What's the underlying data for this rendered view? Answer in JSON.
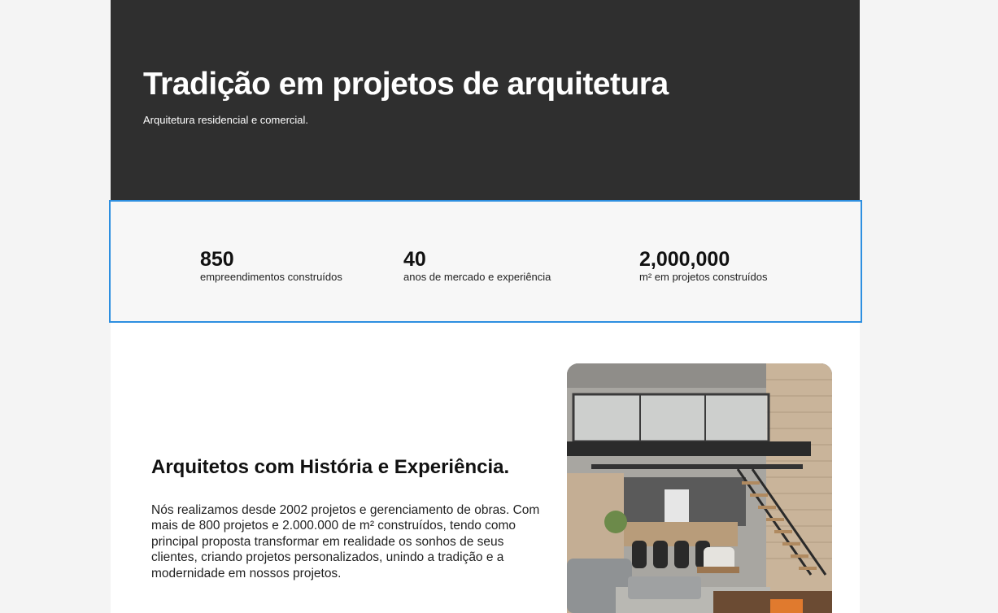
{
  "hero": {
    "title": "Tradição em projetos de arquitetura",
    "subtitle": "Arquitetura residencial e comercial."
  },
  "stats": [
    {
      "value": "850",
      "label": "empreendimentos construídos"
    },
    {
      "value": "40",
      "label": "anos de mercado e experiência"
    },
    {
      "value": "2,000,000",
      "label": "m² em projetos construídos"
    }
  ],
  "about": {
    "title": "Arquitetos com História e Experiência.",
    "text": "Nós realizamos desde 2002 projetos e gerenciamento de obras. Com mais de 800 projetos e 2.000.000 de m² construídos, tendo como principal proposta transformar em realidade os sonhos de seus clientes, criando projetos personalizados, unindo a tradição e a modernidade em nossos projetos."
  },
  "colors": {
    "hero_bg": "#2f2f2f",
    "stats_bg": "#f7f7f7",
    "stats_border": "#2d8fe0",
    "page_bg": "#f4f4f4"
  }
}
